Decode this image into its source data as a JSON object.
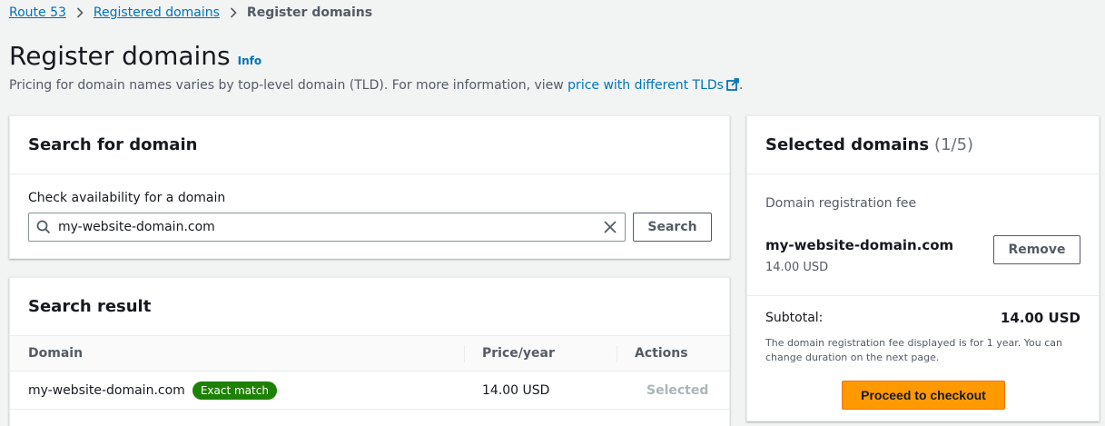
{
  "breadcrumb": {
    "items": [
      "Route 53",
      "Registered domains"
    ],
    "current": "Register domains"
  },
  "header": {
    "title": "Register domains",
    "info": "Info",
    "description": "Pricing for domain names varies by top-level domain (TLD). For more information, view ",
    "description_link": "price with different TLDs",
    "description_end": "."
  },
  "search_panel": {
    "title": "Search for domain",
    "label": "Check availability for a domain",
    "value": "my-website-domain.com",
    "button": "Search"
  },
  "result_panel": {
    "title": "Search result",
    "columns": [
      "Domain",
      "Price/year",
      "Actions"
    ],
    "rows": [
      {
        "domain": "my-website-domain.com",
        "badge": "Exact match",
        "price": "14.00 USD",
        "action": "Selected"
      }
    ]
  },
  "selected_panel": {
    "title": "Selected domains",
    "count": "(1/5)",
    "fee_label": "Domain registration fee",
    "domain": "my-website-domain.com",
    "price": "14.00 USD",
    "remove": "Remove",
    "subtotal_label": "Subtotal:",
    "subtotal_value": "14.00 USD",
    "note": "The domain registration fee displayed is for 1 year. You can change duration on the next page.",
    "checkout": "Proceed to checkout"
  },
  "colors": {
    "link": "#0073bb",
    "primary": "#ff9900",
    "success": "#1d8102",
    "background": "#f2f3f3"
  }
}
